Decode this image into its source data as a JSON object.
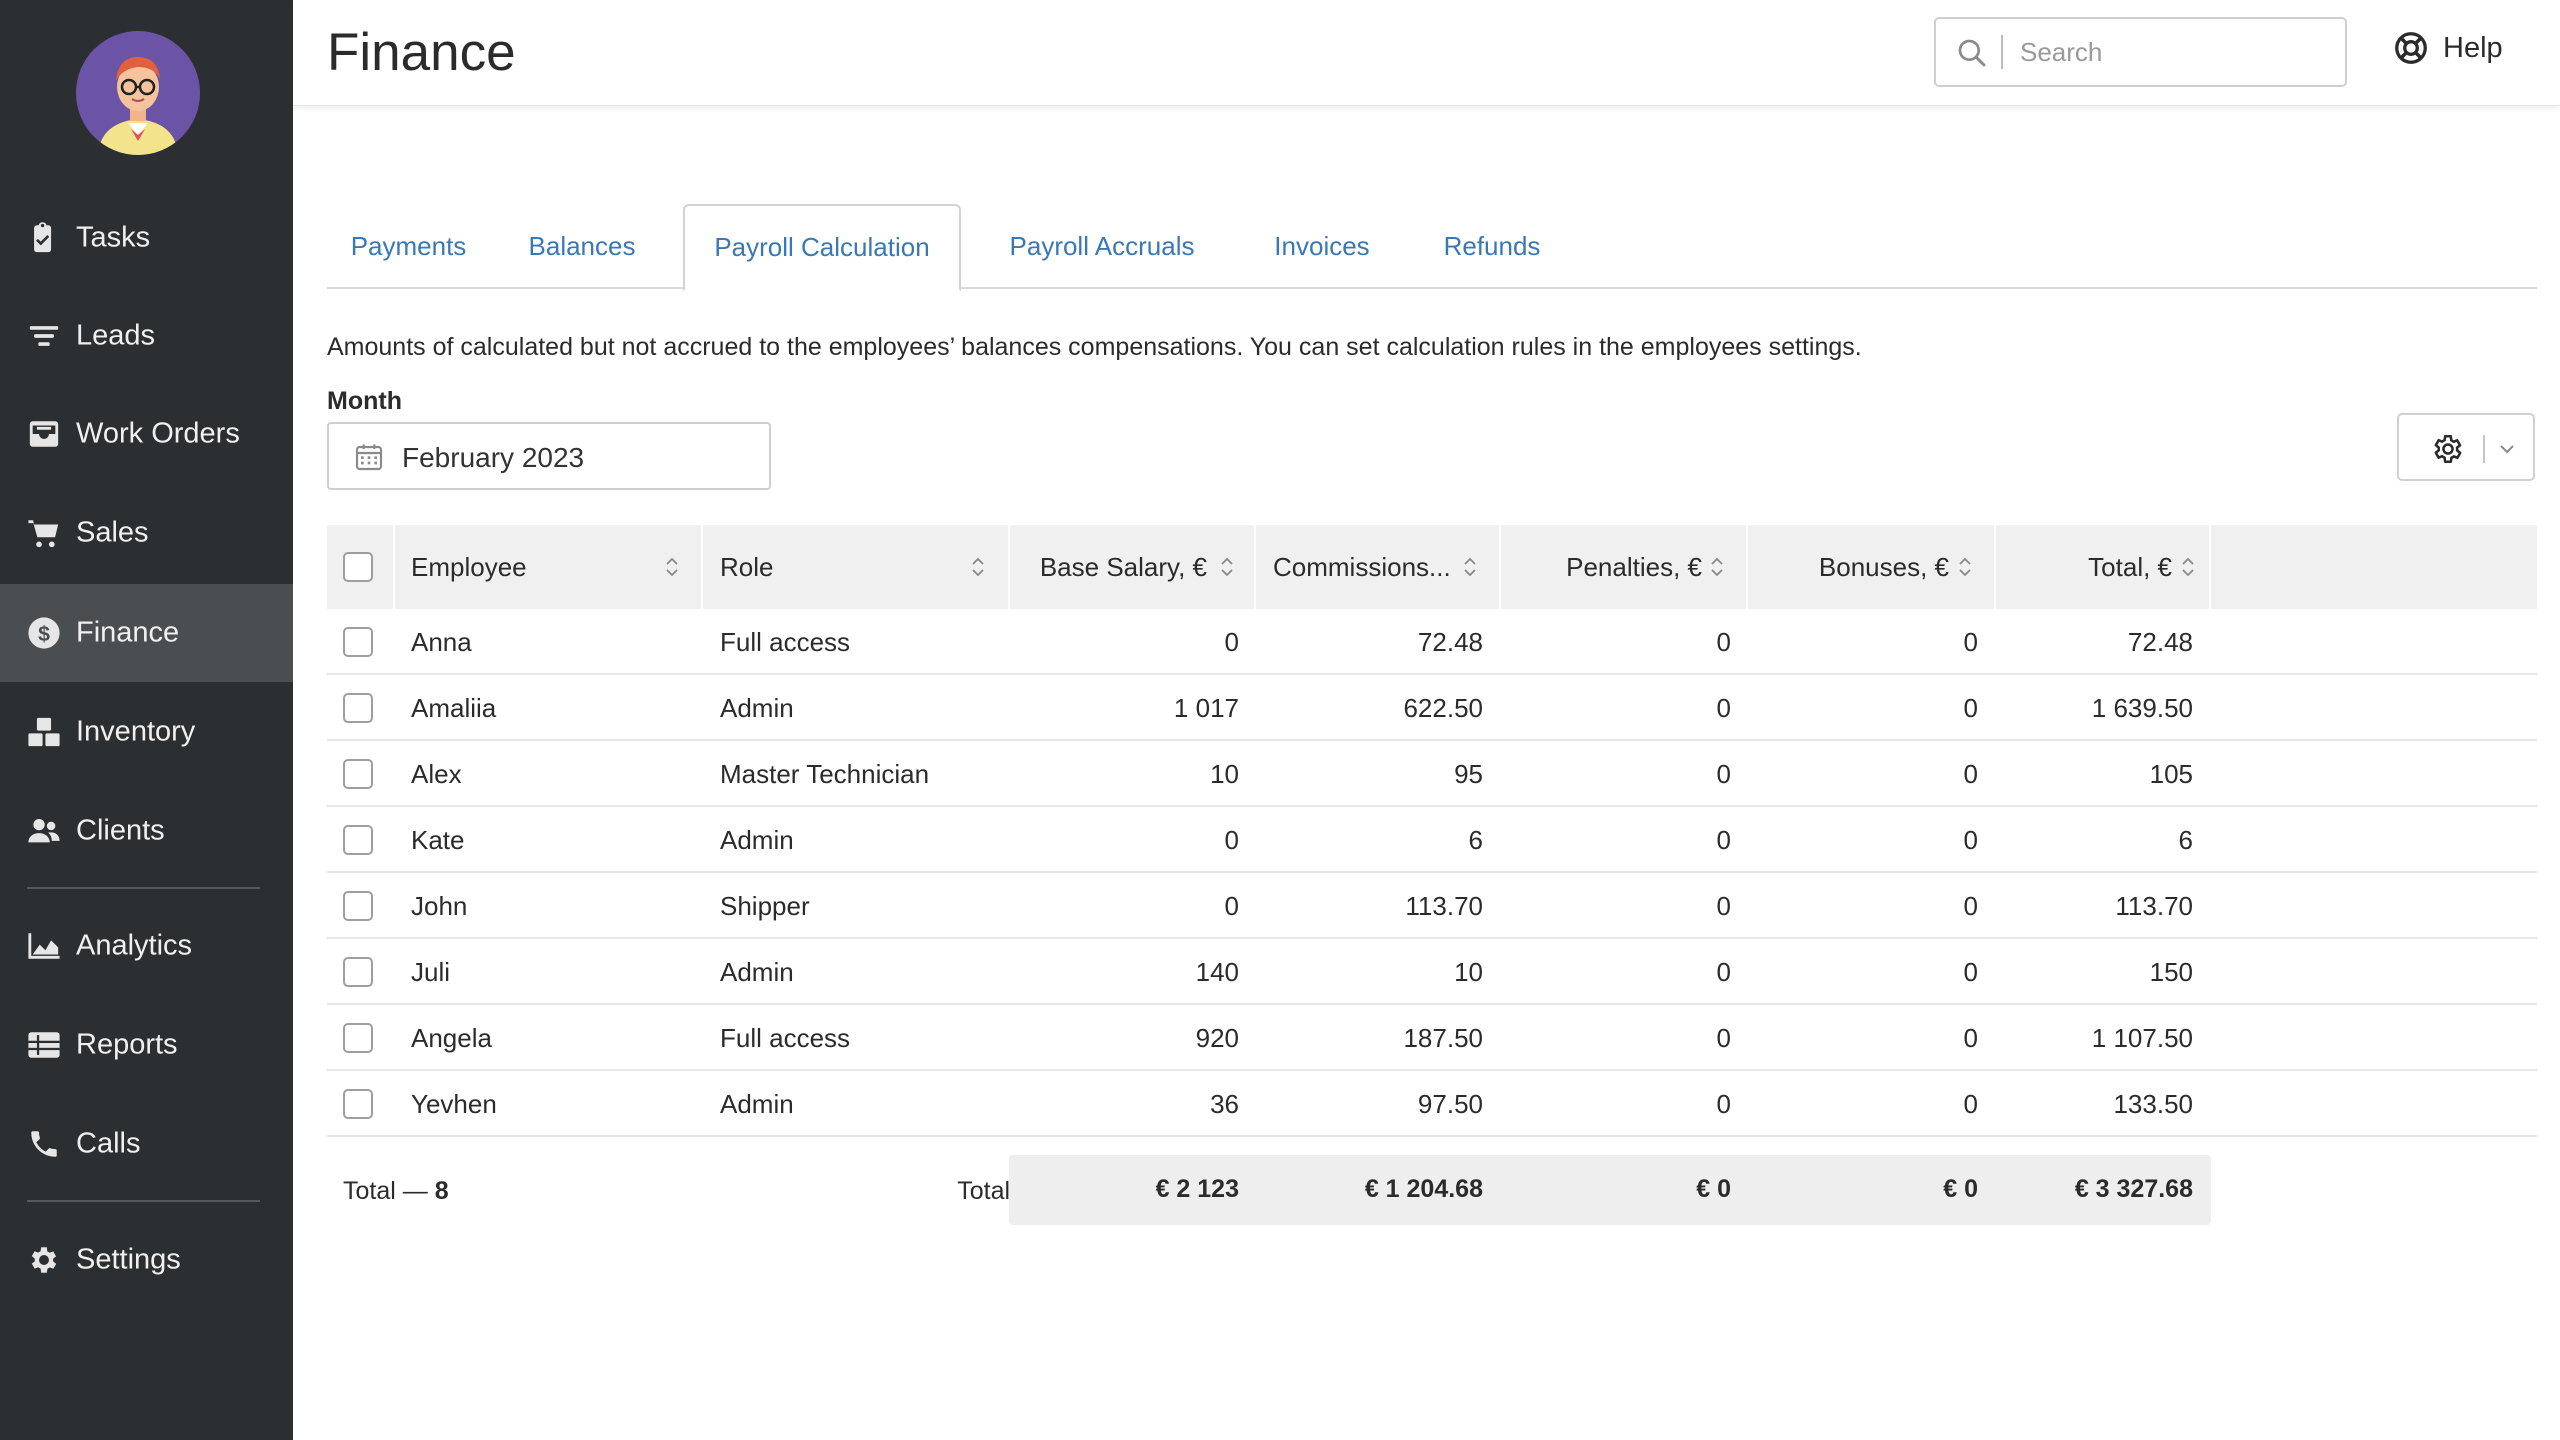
{
  "sidebar": {
    "items": [
      {
        "label": "Tasks",
        "icon": "clipboard-check-icon"
      },
      {
        "label": "Leads",
        "icon": "filter-icon"
      },
      {
        "label": "Work Orders",
        "icon": "inbox-icon"
      },
      {
        "label": "Sales",
        "icon": "cart-icon"
      },
      {
        "label": "Finance",
        "icon": "dollar-icon",
        "active": true
      },
      {
        "label": "Inventory",
        "icon": "boxes-icon"
      },
      {
        "label": "Clients",
        "icon": "users-icon"
      },
      {
        "label": "Analytics",
        "icon": "chart-area-icon"
      },
      {
        "label": "Reports",
        "icon": "list-icon"
      },
      {
        "label": "Calls",
        "icon": "phone-icon"
      },
      {
        "label": "Settings",
        "icon": "gear-icon"
      }
    ]
  },
  "header": {
    "title": "Finance",
    "search_placeholder": "Search",
    "help_label": "Help"
  },
  "tabs": [
    {
      "label": "Payments"
    },
    {
      "label": "Balances"
    },
    {
      "label": "Payroll Calculation",
      "active": true
    },
    {
      "label": "Payroll Accruals"
    },
    {
      "label": "Invoices"
    },
    {
      "label": "Refunds"
    }
  ],
  "description": "Amounts of calculated but not accrued to the employees’ balances compensations. You can set calculation rules in the employees settings.",
  "month": {
    "label": "Month",
    "value": "February 2023"
  },
  "table": {
    "columns": {
      "employee": "Employee",
      "role": "Role",
      "base_salary": "Base Salary, €",
      "commissions": "Commissions...",
      "penalties": "Penalties, €",
      "bonuses": "Bonuses, €",
      "total": "Total, €"
    },
    "rows": [
      {
        "employee": "Anna",
        "role": "Full access",
        "base_salary": "0",
        "commissions": "72.48",
        "penalties": "0",
        "bonuses": "0",
        "total": "72.48"
      },
      {
        "employee": "Amaliia",
        "role": "Admin",
        "base_salary": "1 017",
        "commissions": "622.50",
        "penalties": "0",
        "bonuses": "0",
        "total": "1 639.50"
      },
      {
        "employee": "Alex",
        "role": "Master Technician",
        "base_salary": "10",
        "commissions": "95",
        "penalties": "0",
        "bonuses": "0",
        "total": "105"
      },
      {
        "employee": "Kate",
        "role": "Admin",
        "base_salary": "0",
        "commissions": "6",
        "penalties": "0",
        "bonuses": "0",
        "total": "6"
      },
      {
        "employee": "John",
        "role": "Shipper",
        "base_salary": "0",
        "commissions": "113.70",
        "penalties": "0",
        "bonuses": "0",
        "total": "113.70"
      },
      {
        "employee": "Juli",
        "role": "Admin",
        "base_salary": "140",
        "commissions": "10",
        "penalties": "0",
        "bonuses": "0",
        "total": "150"
      },
      {
        "employee": "Angela",
        "role": "Full access",
        "base_salary": "920",
        "commissions": "187.50",
        "penalties": "0",
        "bonuses": "0",
        "total": "1 107.50"
      },
      {
        "employee": "Yevhen",
        "role": "Admin",
        "base_salary": "36",
        "commissions": "97.50",
        "penalties": "0",
        "bonuses": "0",
        "total": "133.50"
      }
    ],
    "footer": {
      "count_prefix": "Total — ",
      "count": "8",
      "total_label": "Total:",
      "base_salary": "€ 2 123",
      "commissions": "€ 1 204.68",
      "penalties": "€ 0",
      "bonuses": "€ 0",
      "total": "€ 3 327.68"
    }
  }
}
